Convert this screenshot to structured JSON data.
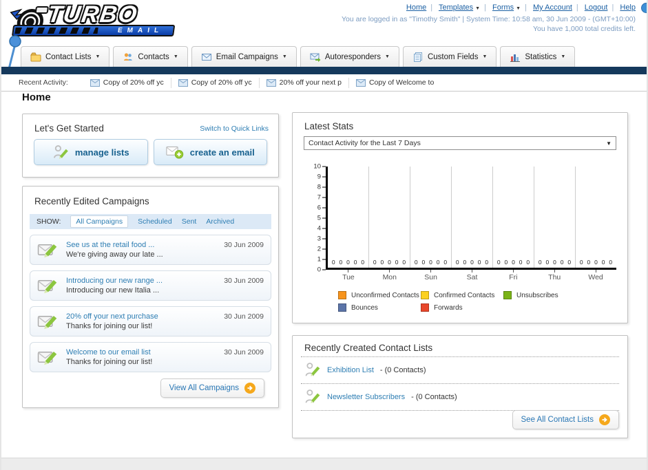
{
  "header": {
    "logo": {
      "title": "TURBO",
      "subtitle": "EMAIL"
    },
    "nav": [
      {
        "label": "Home",
        "dropdown": false
      },
      {
        "label": "Templates",
        "dropdown": true
      },
      {
        "label": "Forms",
        "dropdown": true
      },
      {
        "label": "My Account",
        "dropdown": false
      },
      {
        "label": "Logout",
        "dropdown": false
      },
      {
        "label": "Help",
        "dropdown": false
      }
    ],
    "login_line1": "You are logged in as \"Timothy Smith\" | System Time: 10:58 am, 30 Jun 2009 - (GMT+10:00)",
    "login_line2": "You have 1,000 total credits left."
  },
  "tabs": [
    {
      "label": "Contact Lists"
    },
    {
      "label": "Contacts"
    },
    {
      "label": "Email Campaigns"
    },
    {
      "label": "Autoresponders"
    },
    {
      "label": "Custom Fields"
    },
    {
      "label": "Statistics"
    }
  ],
  "recent_activity": {
    "label": "Recent Activity:",
    "items": [
      "Copy of 20% off yc",
      "Copy of 20% off yc",
      "20% off your next p",
      "Copy of Welcome to"
    ]
  },
  "page_title": "Home",
  "get_started": {
    "title": "Let's Get Started",
    "switch_link": "Switch to Quick Links",
    "manage_lists_label": "manage lists",
    "create_email_label": "create an email"
  },
  "campaigns": {
    "title": "Recently Edited Campaigns",
    "show_label": "SHOW:",
    "filters": [
      "All Campaigns",
      "Scheduled",
      "Sent",
      "Archived"
    ],
    "active_filter": "All Campaigns",
    "items": [
      {
        "title": "See us at the retail food ...",
        "subtitle": "We're giving away our late ...",
        "date": "30 Jun 2009"
      },
      {
        "title": "Introducing our new range ...",
        "subtitle": "Introducing our new Italia ...",
        "date": "30 Jun 2009"
      },
      {
        "title": "20% off your next purchase",
        "subtitle": "Thanks for joining our list!",
        "date": "30 Jun 2009"
      },
      {
        "title": "Welcome to our email list",
        "subtitle": "Thanks for joining our list!",
        "date": "30 Jun 2009"
      }
    ],
    "view_all_label": "View All Campaigns"
  },
  "stats": {
    "title": "Latest Stats",
    "select_value": "Contact Activity for the Last 7 Days",
    "chart_data": {
      "type": "bar",
      "title": "Contact Activity for the Last 7 Days",
      "categories": [
        "Tue",
        "Mon",
        "Sun",
        "Sat",
        "Fri",
        "Thu",
        "Wed"
      ],
      "series": [
        {
          "name": "Unconfirmed Contacts",
          "color": "#F7941D",
          "values": [
            0,
            0,
            0,
            0,
            0,
            0,
            0
          ]
        },
        {
          "name": "Confirmed Contacts",
          "color": "#FCD11F",
          "values": [
            0,
            0,
            0,
            0,
            0,
            0,
            0
          ]
        },
        {
          "name": "Unsubscribes",
          "color": "#7AB317",
          "values": [
            0,
            0,
            0,
            0,
            0,
            0,
            0
          ]
        },
        {
          "name": "Bounces",
          "color": "#5B74A8",
          "values": [
            0,
            0,
            0,
            0,
            0,
            0,
            0
          ]
        },
        {
          "name": "Forwards",
          "color": "#E8472B",
          "values": [
            0,
            0,
            0,
            0,
            0,
            0,
            0
          ]
        }
      ],
      "ylim": [
        0,
        10
      ],
      "yticks": [
        0,
        1,
        2,
        3,
        4,
        5,
        6,
        7,
        8,
        9,
        10
      ],
      "grid": true,
      "legend_position": "bottom"
    }
  },
  "contact_lists": {
    "title": "Recently Created Contact Lists",
    "items": [
      {
        "name": "Exhibition List",
        "detail": "- (0 Contacts)"
      },
      {
        "name": "Newsletter Subscribers",
        "detail": "- (0 Contacts)"
      }
    ],
    "see_all_label": "See All Contact Lists"
  }
}
